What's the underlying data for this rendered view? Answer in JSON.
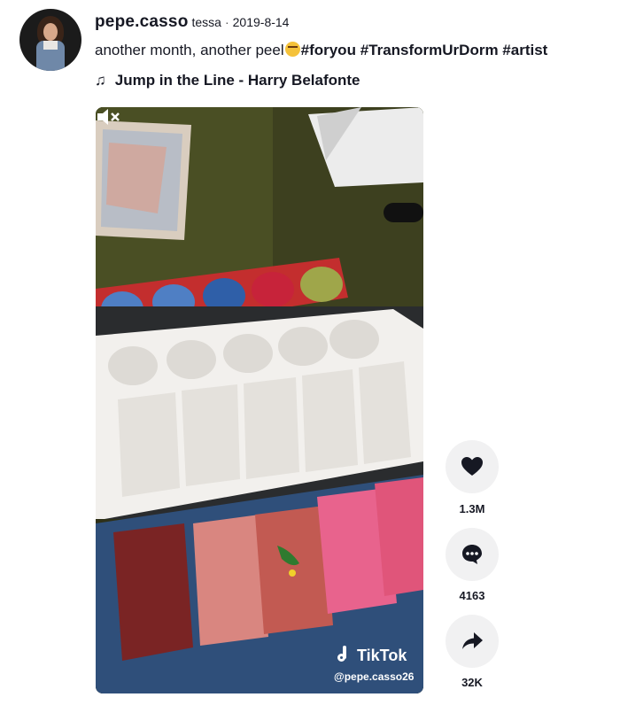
{
  "author": {
    "username": "pepe.casso",
    "nickname": "tessa",
    "separator": "·",
    "date": "2019-8-14"
  },
  "caption": {
    "text": "another month, another peel",
    "emoji": "star-struck-emoji",
    "hashtags": [
      "#foryou",
      "#TransformUrDorm",
      "#artist"
    ]
  },
  "music": {
    "title": "Jump in the Line - Harry Belafonte"
  },
  "video": {
    "watermark_logo": "TikTok",
    "watermark_handle": "@pepe.casso26"
  },
  "actions": {
    "likes": "1.3M",
    "comments": "4163",
    "shares": "32K"
  }
}
